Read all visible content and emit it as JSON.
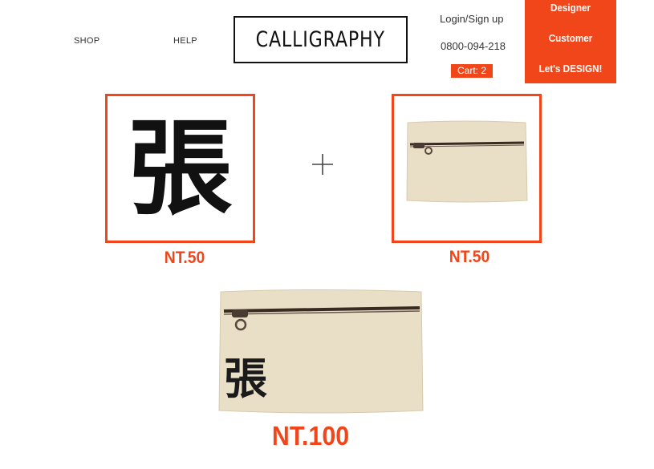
{
  "header": {
    "shop_label": "SHOP",
    "help_label": "HELP",
    "logo_text": "CALLIGRAPHY",
    "login_label": "Login/Sign up",
    "phone": "0800-094-218",
    "cart_label": "Cart: 2"
  },
  "menu": {
    "items": [
      {
        "label": "Designer"
      },
      {
        "label": "Customer"
      },
      {
        "label": "Let's DESIGN!"
      }
    ]
  },
  "products": {
    "calligraphy": {
      "price": "NT.50",
      "character": "張"
    },
    "pouch": {
      "price": "NT.50"
    },
    "combined": {
      "price": "NT.100",
      "character": "張"
    }
  },
  "colors": {
    "accent": "#f0461a",
    "canvas": "#e9dfc7"
  },
  "icons": {
    "plus": "plus-icon"
  }
}
